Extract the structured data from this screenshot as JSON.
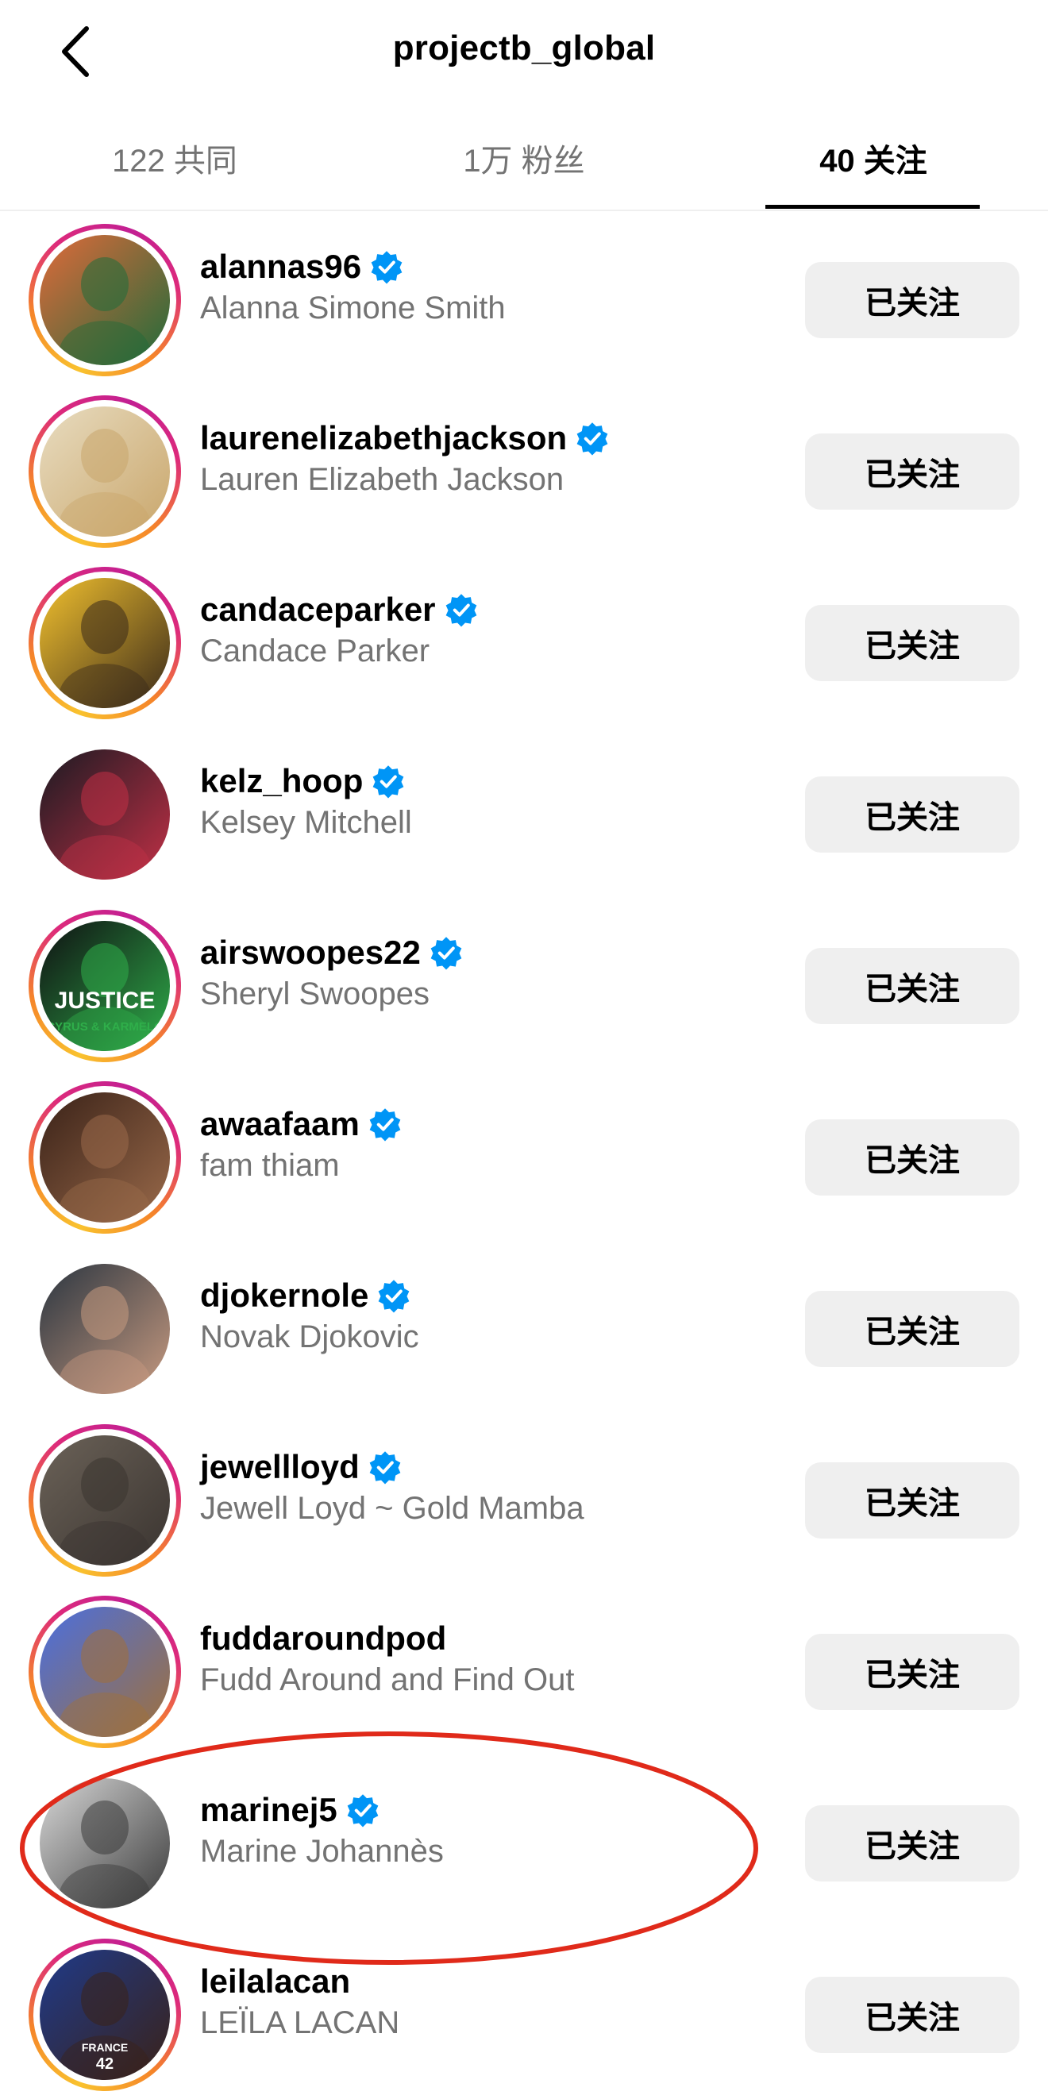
{
  "header": {
    "title": "projectb_global",
    "back_icon": "chevron-left-icon"
  },
  "tabs": [
    {
      "label": "122 共同",
      "active": false
    },
    {
      "label": "1万 粉丝",
      "active": false
    },
    {
      "label": "40 关注",
      "active": true
    }
  ],
  "users": [
    {
      "username": "alannas96",
      "full_name": "Alanna Simone Smith",
      "verified": true,
      "story_ring": true,
      "button": "已关注",
      "avatar_colors": [
        "#e06a3a",
        "#1f6b3a"
      ]
    },
    {
      "username": "laurenelizabethjackson",
      "full_name": "Lauren Elizabeth Jackson",
      "verified": true,
      "story_ring": true,
      "button": "已关注",
      "avatar_colors": [
        "#e8dcc0",
        "#c9a66b"
      ]
    },
    {
      "username": "candaceparker",
      "full_name": "Candace Parker",
      "verified": true,
      "story_ring": true,
      "button": "已关注",
      "avatar_colors": [
        "#f2c12e",
        "#3a2a1a"
      ]
    },
    {
      "username": "kelz_hoop",
      "full_name": "Kelsey Mitchell",
      "verified": true,
      "story_ring": false,
      "button": "已关注",
      "avatar_colors": [
        "#1a1a22",
        "#c23046"
      ]
    },
    {
      "username": "airswoopes22",
      "full_name": "Sheryl Swoopes",
      "verified": true,
      "story_ring": true,
      "button": "已关注",
      "avatar_colors": [
        "#0f0f12",
        "#2fae4a"
      ],
      "avatar_text": "JUSTICE"
    },
    {
      "username": "awaafaam",
      "full_name": "fam thiam",
      "verified": true,
      "story_ring": true,
      "button": "已关注",
      "avatar_colors": [
        "#3a2218",
        "#9a6a4a"
      ]
    },
    {
      "username": "djokernole",
      "full_name": "Novak Djokovic",
      "verified": true,
      "story_ring": false,
      "button": "已关注",
      "avatar_colors": [
        "#2a3540",
        "#c79a80"
      ]
    },
    {
      "username": "jewellloyd",
      "full_name": "Jewell Loyd ~ Gold Mamba",
      "verified": true,
      "story_ring": true,
      "button": "已关注",
      "avatar_colors": [
        "#6b6258",
        "#3a3430"
      ]
    },
    {
      "username": "fuddaroundpod",
      "full_name": "Fudd Around and Find Out",
      "verified": false,
      "story_ring": true,
      "button": "已关注",
      "avatar_colors": [
        "#4a6fe0",
        "#a0703a"
      ]
    },
    {
      "username": "marinej5",
      "full_name": "Marine Johannès",
      "verified": true,
      "story_ring": false,
      "button": "已关注",
      "avatar_colors": [
        "#d8d8d8",
        "#3a3a3a"
      ]
    },
    {
      "username": "leilalacan",
      "full_name": "LEÏLA LACAN",
      "verified": false,
      "story_ring": true,
      "button": "已关注",
      "avatar_colors": [
        "#1f3a8a",
        "#3a2218"
      ],
      "avatar_text": "FRANCE 42"
    }
  ],
  "colors": {
    "verified_blue": "#0095f6",
    "annotation_red": "#e02a1a",
    "secondary_text": "#737373",
    "button_bg": "#efefef"
  }
}
